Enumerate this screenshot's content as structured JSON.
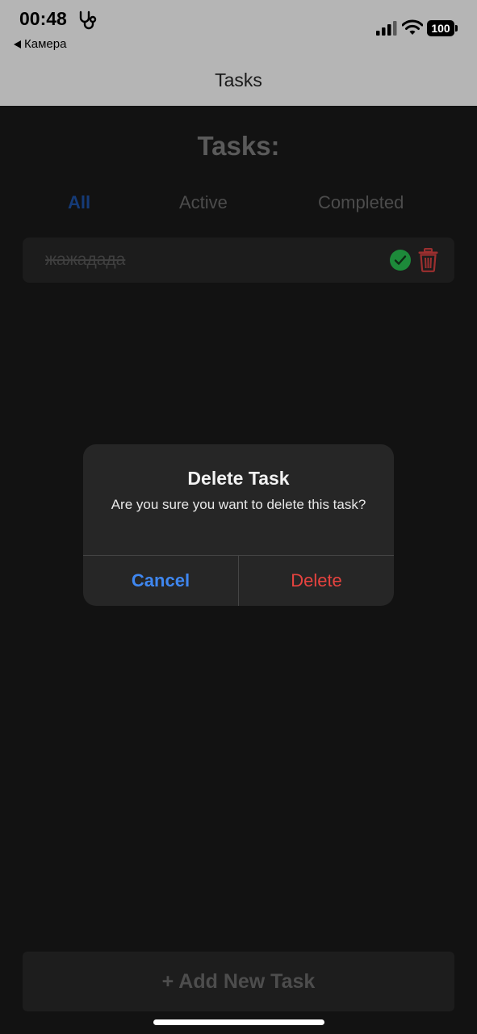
{
  "status_bar": {
    "time": "00:48",
    "back_label": "Камера",
    "battery": "100",
    "icons": [
      "stethoscope-icon",
      "signal-icon",
      "wifi-icon",
      "battery-icon"
    ]
  },
  "nav": {
    "title": "Tasks"
  },
  "page": {
    "heading": "Tasks:"
  },
  "filters": {
    "items": [
      {
        "label": "All",
        "active": true
      },
      {
        "label": "Active",
        "active": false
      },
      {
        "label": "Completed",
        "active": false
      }
    ]
  },
  "tasks": [
    {
      "text": "жажадада",
      "completed": true
    }
  ],
  "dialog": {
    "title": "Delete Task",
    "message": "Are you sure you want to delete this task?",
    "cancel_label": "Cancel",
    "delete_label": "Delete"
  },
  "footer": {
    "add_label": "+ Add New Task"
  },
  "colors": {
    "accent": "#3f87f0",
    "destructive": "#e6433f",
    "success": "#1d8a3a",
    "trash": "#9c2f2f"
  }
}
